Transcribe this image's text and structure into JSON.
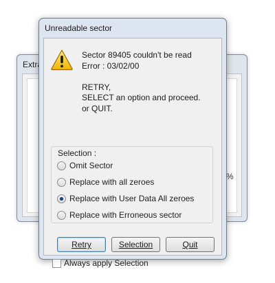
{
  "background_window": {
    "title": "Extra",
    "percent_text": "%"
  },
  "dialog": {
    "title": "Unreadable sector",
    "icon": "warning-icon",
    "message": {
      "line1": "Sector 89405 couldn't be read",
      "line2": "Error : 03/02/00",
      "line3": "RETRY,",
      "line4": "SELECT an option and proceed.",
      "line5": "or QUIT."
    },
    "selection": {
      "label": "Selection :",
      "options": [
        {
          "label": "Omit Sector",
          "checked": false
        },
        {
          "label": "Replace with all zeroes",
          "checked": false
        },
        {
          "label": "Replace with User Data All zeroes",
          "checked": true
        },
        {
          "label": "Replace with Erroneous sector",
          "checked": false
        }
      ]
    },
    "buttons": {
      "retry": "Retry",
      "selection": "Selection",
      "quit": "Quit"
    },
    "always_apply": {
      "label": "Always apply Selection",
      "checked": false
    }
  }
}
